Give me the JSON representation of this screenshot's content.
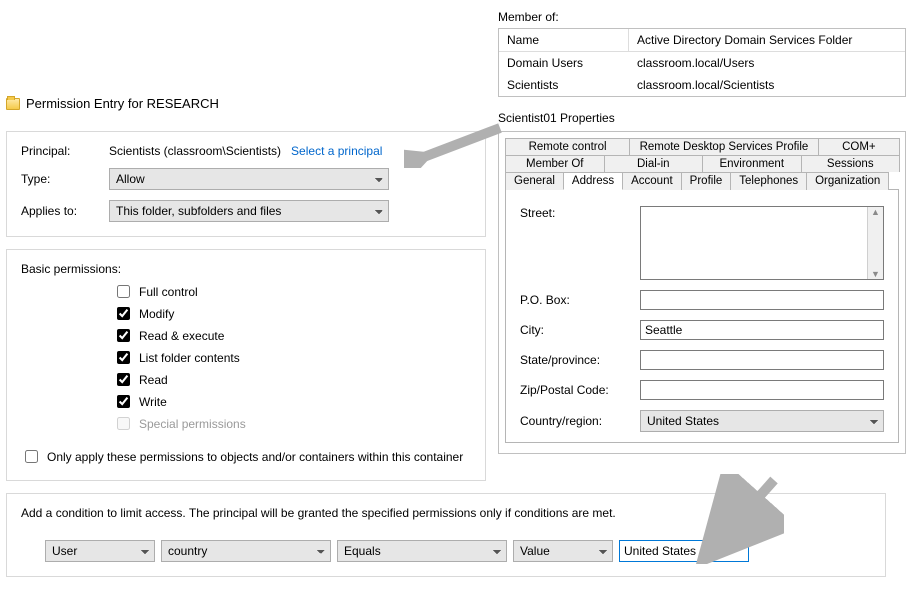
{
  "perm_title": "Permission Entry for RESEARCH",
  "principal_label": "Principal:",
  "principal_value": "Scientists (classroom\\Scientists)",
  "select_principal": "Select a principal",
  "type_label": "Type:",
  "type_value": "Allow",
  "applies_label": "Applies to:",
  "applies_value": "This folder, subfolders and files",
  "basic_permissions_label": "Basic permissions:",
  "perms": {
    "full_control": {
      "label": "Full control",
      "checked": false
    },
    "modify": {
      "label": "Modify",
      "checked": true
    },
    "read_execute": {
      "label": "Read & execute",
      "checked": true
    },
    "list_folder": {
      "label": "List folder contents",
      "checked": true
    },
    "read": {
      "label": "Read",
      "checked": true
    },
    "write": {
      "label": "Write",
      "checked": true
    },
    "special": {
      "label": "Special permissions",
      "checked": false,
      "disabled": true
    }
  },
  "only_apply_label": "Only apply these permissions to objects and/or containers within this container",
  "condition_text": "Add a condition to limit access. The principal will be granted the specified permissions only if conditions are met.",
  "condition": {
    "subject": "User",
    "attribute": "country",
    "operator": "Equals",
    "value_type": "Value",
    "value": "United States"
  },
  "member_of_label": "Member of:",
  "member_columns": {
    "name": "Name",
    "folder": "Active Directory Domain Services Folder"
  },
  "memberships": [
    {
      "name": "Domain Users",
      "folder": "classroom.local/Users"
    },
    {
      "name": "Scientists",
      "folder": "classroom.local/Scientists"
    }
  ],
  "properties_title": "Scientist01 Properties",
  "tabs_row1": [
    "Remote control",
    "Remote Desktop Services Profile",
    "COM+"
  ],
  "tabs_row2": [
    "Member Of",
    "Dial-in",
    "Environment",
    "Sessions"
  ],
  "tabs_row3": [
    "General",
    "Address",
    "Account",
    "Profile",
    "Telephones",
    "Organization"
  ],
  "active_tab": "Address",
  "address": {
    "street_label": "Street:",
    "street": "",
    "pobox_label": "P.O. Box:",
    "pobox": "",
    "city_label": "City:",
    "city": "Seattle",
    "state_label": "State/province:",
    "state": "",
    "zip_label": "Zip/Postal Code:",
    "zip": "",
    "country_label": "Country/region:",
    "country": "United States"
  }
}
